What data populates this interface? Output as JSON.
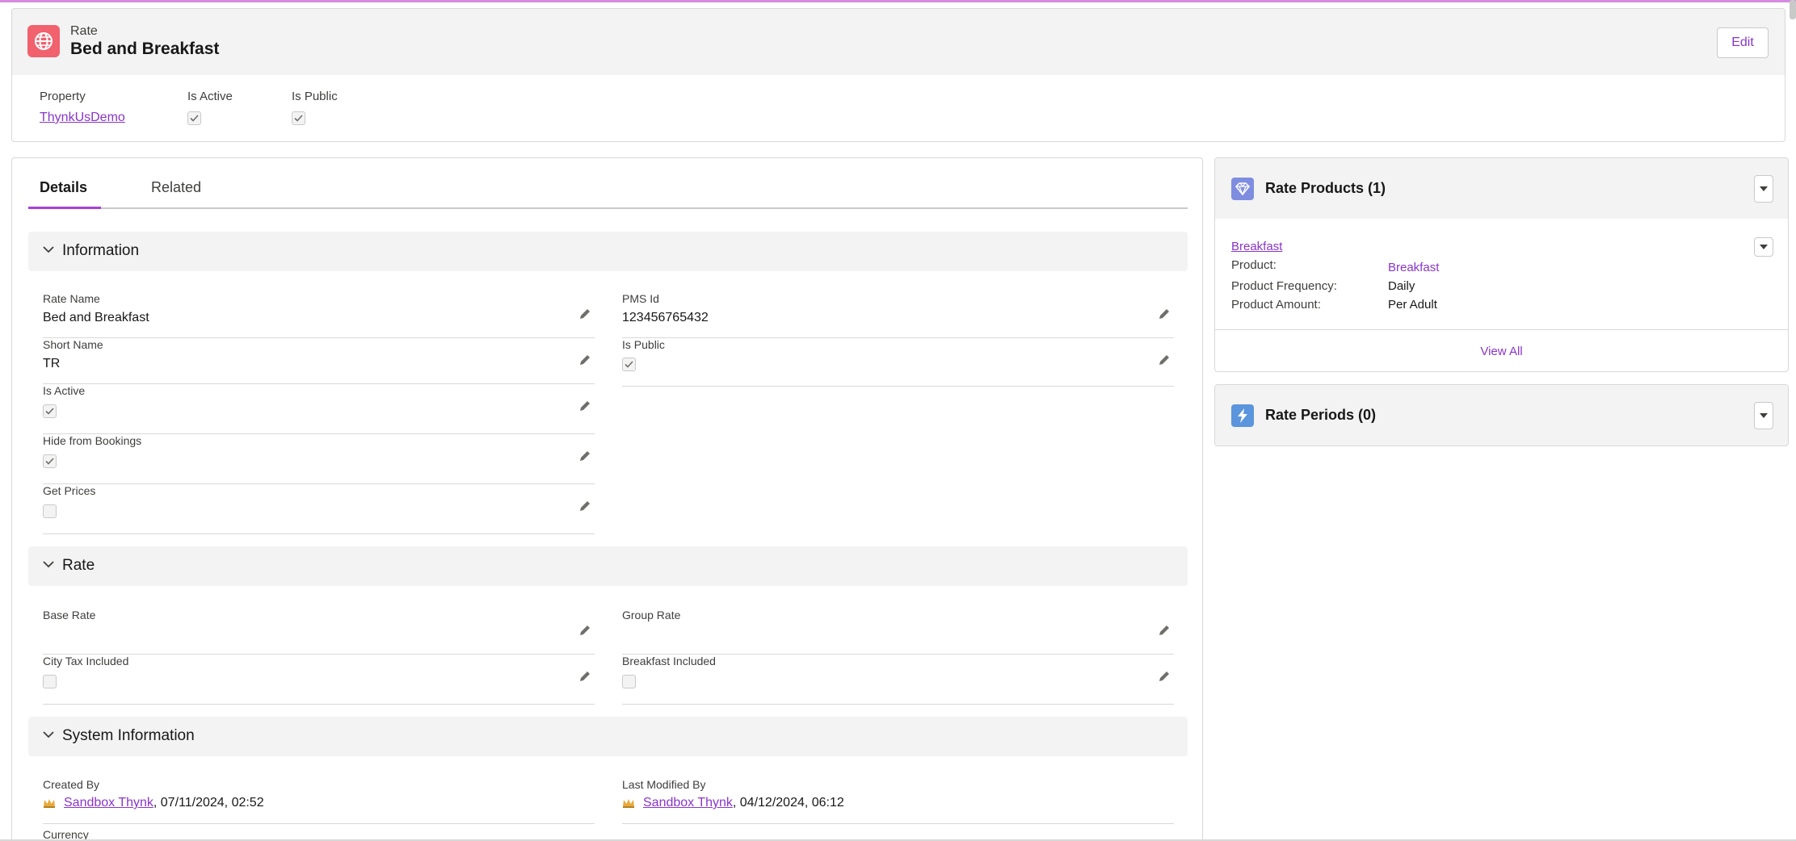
{
  "header": {
    "object_type": "Rate",
    "title": "Bed and Breakfast",
    "edit_label": "Edit",
    "icon": "globe-icon",
    "accent_color": "#f1616e"
  },
  "highlights": {
    "property_label": "Property",
    "property_value": "ThynkUsDemo",
    "is_active_label": "Is Active",
    "is_active": true,
    "is_public_label": "Is Public",
    "is_public": true
  },
  "tabs": [
    {
      "label": "Details",
      "active": true
    },
    {
      "label": "Related",
      "active": false
    }
  ],
  "sections": {
    "information": {
      "title": "Information",
      "rate_name_label": "Rate Name",
      "rate_name": "Bed and Breakfast",
      "pms_id_label": "PMS Id",
      "pms_id": "123456765432",
      "short_name_label": "Short Name",
      "short_name": "TR",
      "is_public_label": "Is Public",
      "is_public": true,
      "is_active_label": "Is Active",
      "is_active": true,
      "hide_label": "Hide from Bookings",
      "hide": true,
      "get_prices_label": "Get Prices",
      "get_prices": false
    },
    "rate": {
      "title": "Rate",
      "base_rate_label": "Base Rate",
      "base_rate": "",
      "group_rate_label": "Group Rate",
      "group_rate": "",
      "city_tax_label": "City Tax Included",
      "city_tax": false,
      "breakfast_label": "Breakfast Included",
      "breakfast": false
    },
    "system": {
      "title": "System Information",
      "created_by_label": "Created By",
      "created_by_user": "Sandbox Thynk",
      "created_by_date": ", 07/11/2024, 02:52",
      "modified_by_label": "Last Modified By",
      "modified_by_user": "Sandbox Thynk",
      "modified_by_date": ", 04/12/2024, 06:12",
      "currency_label": "Currency"
    }
  },
  "related": {
    "rate_products": {
      "title": "Rate Products (1)",
      "icon": "gem-icon",
      "icon_color": "#7f8de1",
      "item_name": "Breakfast",
      "product_label": "Product:",
      "product_value": "Breakfast",
      "frequency_label": "Product Frequency:",
      "frequency_value": "Daily",
      "amount_label": "Product Amount:",
      "amount_value": "Per Adult",
      "view_all": "View All"
    },
    "rate_periods": {
      "title": "Rate Periods (0)",
      "icon": "lightning-icon",
      "icon_color": "#5a95dd"
    }
  }
}
